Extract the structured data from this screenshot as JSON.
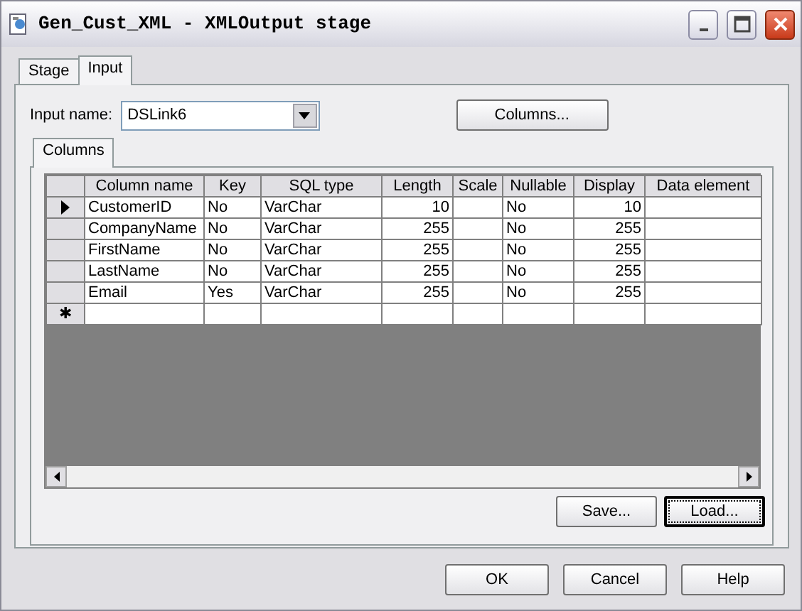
{
  "window": {
    "title": "Gen_Cust_XML - XMLOutput stage"
  },
  "tabs": [
    {
      "label": "Stage",
      "selected": false
    },
    {
      "label": "Input",
      "selected": true
    }
  ],
  "input_name": {
    "label": "Input name:",
    "value": "DSLink6"
  },
  "columns_button": "Columns...",
  "inner_tabs": [
    {
      "label": "Columns",
      "selected": true
    }
  ],
  "table": {
    "columns": [
      "Column name",
      "Key",
      "SQL type",
      "Length",
      "Scale",
      "Nullable",
      "Display",
      "Data element"
    ],
    "rows": [
      {
        "current": true,
        "cells": [
          "CustomerID",
          "No",
          "VarChar",
          "10",
          "",
          "No",
          "10",
          ""
        ]
      },
      {
        "current": false,
        "cells": [
          "CompanyName",
          "No",
          "VarChar",
          "255",
          "",
          "No",
          "255",
          ""
        ]
      },
      {
        "current": false,
        "cells": [
          "FirstName",
          "No",
          "VarChar",
          "255",
          "",
          "No",
          "255",
          ""
        ]
      },
      {
        "current": false,
        "cells": [
          "LastName",
          "No",
          "VarChar",
          "255",
          "",
          "No",
          "255",
          ""
        ]
      },
      {
        "current": false,
        "cells": [
          "Email",
          "Yes",
          "VarChar",
          "255",
          "",
          "No",
          "255",
          ""
        ]
      }
    ],
    "new_row_marker": "✱"
  },
  "grid_buttons": [
    {
      "label": "Save...",
      "focused": false
    },
    {
      "label": "Load...",
      "focused": true
    }
  ],
  "dialog_buttons": [
    "OK",
    "Cancel",
    "Help"
  ]
}
